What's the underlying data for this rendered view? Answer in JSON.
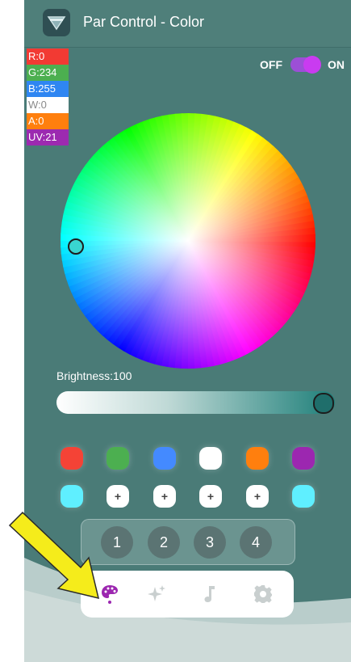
{
  "header": {
    "title": "Par Control - Color"
  },
  "power_toggle": {
    "off_label": "OFF",
    "on_label": "ON",
    "state": "on"
  },
  "dmx_values": [
    {
      "label": "R:0",
      "color": "#f23a33"
    },
    {
      "label": "G:234",
      "color": "#4caf50"
    },
    {
      "label": "B:255",
      "color": "#2f86f2"
    },
    {
      "label": "W:0",
      "color": "#ffffff"
    },
    {
      "label": "A:0",
      "color": "#ff7f0e"
    },
    {
      "label": "UV:21",
      "color": "#9c2ab0"
    }
  ],
  "brightness": {
    "label": "Brightness:100",
    "value": 100
  },
  "color_swatches": [
    "#f44336",
    "#4caf50",
    "#448aff",
    "#ffffff",
    "#ff7f0e",
    "#9c27b0"
  ],
  "custom_swatches": [
    {
      "type": "color",
      "color": "#5fefff"
    },
    {
      "type": "add",
      "label": "+"
    },
    {
      "type": "add",
      "label": "+"
    },
    {
      "type": "add",
      "label": "+"
    },
    {
      "type": "add",
      "label": "+"
    },
    {
      "type": "color",
      "color": "#5fefff"
    }
  ],
  "presets": [
    "1",
    "2",
    "3",
    "4"
  ],
  "nav": [
    {
      "name": "color",
      "icon": "palette-icon",
      "active": true
    },
    {
      "name": "effects",
      "icon": "sparkles-icon",
      "active": false
    },
    {
      "name": "music",
      "icon": "music-note-icon",
      "active": false
    },
    {
      "name": "settings",
      "icon": "gear-icon",
      "active": false
    }
  ],
  "colors": {
    "accent": "#9c27b0",
    "background": "#4a7b77",
    "arrow": "#f5ec1b"
  }
}
